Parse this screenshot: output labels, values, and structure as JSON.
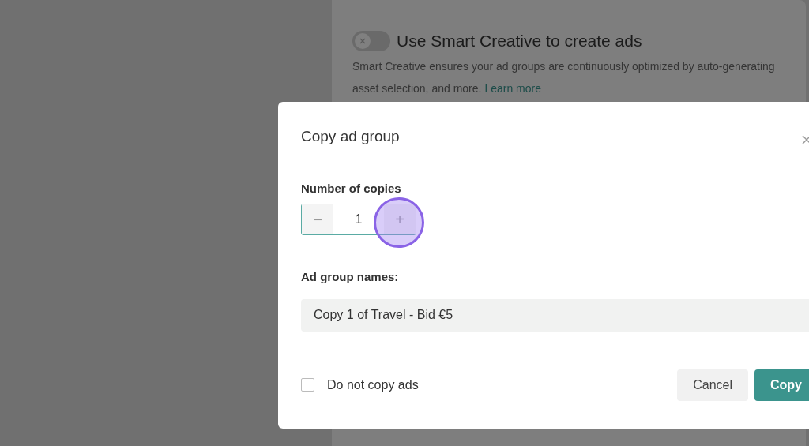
{
  "background": {
    "smart_creative": {
      "title": "Use Smart Creative to create ads",
      "on": false,
      "description": "Smart Creative ensures your ad groups are continuously optimized by auto-generating",
      "description_line2": "asset selection, and more.",
      "link": "Learn more"
    }
  },
  "dialog": {
    "title": "Copy ad group",
    "copies": {
      "label": "Number of copies",
      "value": "1",
      "decrement": "−",
      "increment": "+"
    },
    "names": {
      "label": "Ad group names:",
      "items": [
        "Copy 1 of Travel - Bid €5"
      ]
    },
    "checkbox": {
      "label": "Do not copy ads",
      "checked": false
    },
    "buttons": [
      {
        "label": "Cancel",
        "kind": "secondary"
      },
      {
        "label": "Copy",
        "kind": "primary"
      }
    ]
  }
}
